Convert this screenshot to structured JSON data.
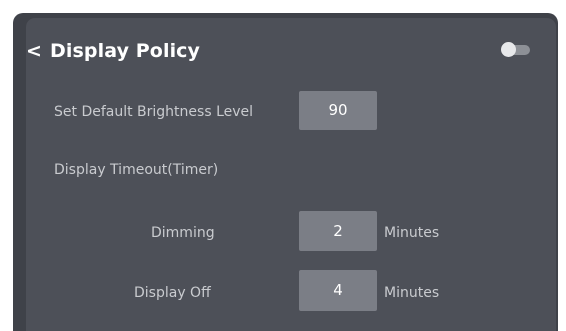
{
  "header": {
    "back_glyph": "<",
    "title": "Display Policy"
  },
  "toggle": {
    "state": "off",
    "icon": "toggle-icon"
  },
  "brightness": {
    "label": "Set Default Brightness Level",
    "value": "90"
  },
  "timeout": {
    "section_label": "Display Timeout(Timer)",
    "dimming": {
      "label": "Dimming",
      "value": "2",
      "unit": "Minutes"
    },
    "display_off": {
      "label": "Display Off",
      "value": "4",
      "unit": "Minutes"
    }
  },
  "colors": {
    "frame": "#3f4249",
    "panel": "#4d5058",
    "input_bg": "#7b7e86",
    "text": "#ffffff",
    "muted_text": "#c9cbcf"
  }
}
